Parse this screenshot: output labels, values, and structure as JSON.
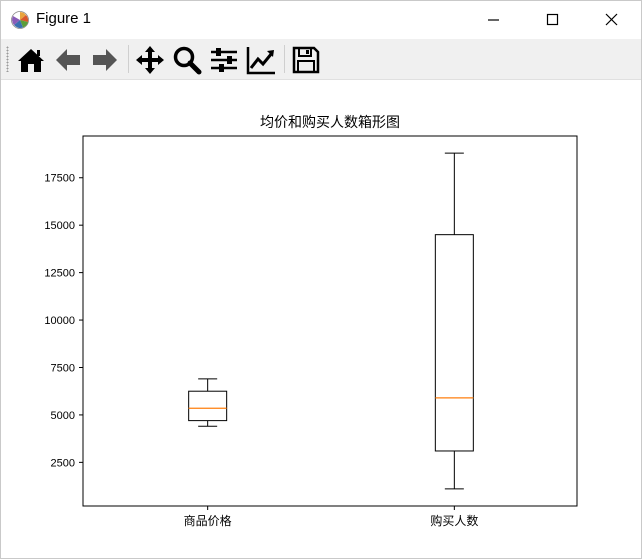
{
  "window": {
    "title": "Figure 1"
  },
  "toolbar": {
    "tools": [
      {
        "name": "home-icon"
      },
      {
        "name": "back-arrow-icon"
      },
      {
        "name": "forward-arrow-icon"
      },
      {
        "name": "pan-move-icon"
      },
      {
        "name": "zoom-magnifier-icon"
      },
      {
        "name": "configure-subplots-icon"
      },
      {
        "name": "edit-axis-curve-icon"
      },
      {
        "name": "save-floppy-icon"
      }
    ]
  },
  "colors": {
    "median": "#ff7f0e",
    "box": "#000000",
    "toolbar_bg": "#f0f0f0"
  },
  "chart_data": {
    "type": "boxplot",
    "title": "均价和购买人数箱形图",
    "categories": [
      "商品价格",
      "购买人数"
    ],
    "ylim": [
      200,
      19700
    ],
    "yticks": [
      2500,
      5000,
      7500,
      10000,
      12500,
      15000,
      17500
    ],
    "ytick_labels": [
      "2500",
      "5000",
      "7500",
      "10000",
      "12500",
      "15000",
      "17500"
    ],
    "boxes": [
      {
        "min": 4400,
        "q1": 4700,
        "median": 5350,
        "q3": 6250,
        "max": 6900
      },
      {
        "min": 1100,
        "q1": 3100,
        "median": 5900,
        "q3": 14500,
        "max": 18800
      }
    ],
    "grid": false
  }
}
